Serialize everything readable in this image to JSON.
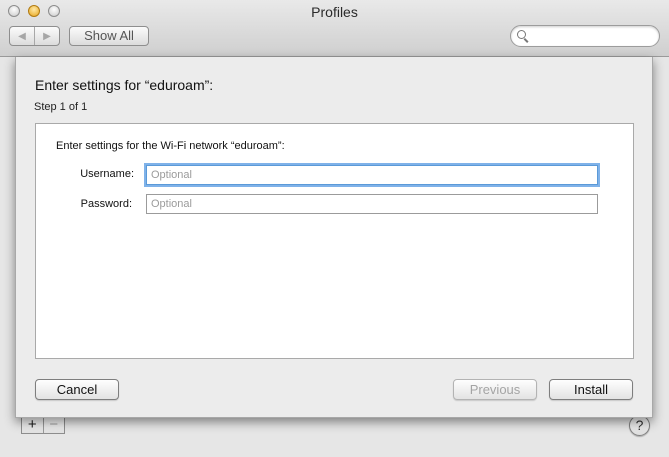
{
  "window": {
    "title": "Profiles"
  },
  "toolbar": {
    "back_icon": "chevron-left-icon",
    "forward_icon": "chevron-right-icon",
    "show_all_label": "Show All",
    "search_placeholder": ""
  },
  "sheet": {
    "title": "Enter settings for “eduroam”:",
    "step": "Step 1 of 1",
    "description": "Enter settings for the Wi-Fi network “eduroam”:",
    "username_label": "Username:",
    "username_placeholder": "Optional",
    "password_label": "Password:",
    "password_placeholder": "Optional",
    "cancel_label": "Cancel",
    "previous_label": "Previous",
    "install_label": "Install"
  },
  "footer": {
    "add_label": "+",
    "remove_label": "−",
    "help_label": "?"
  }
}
